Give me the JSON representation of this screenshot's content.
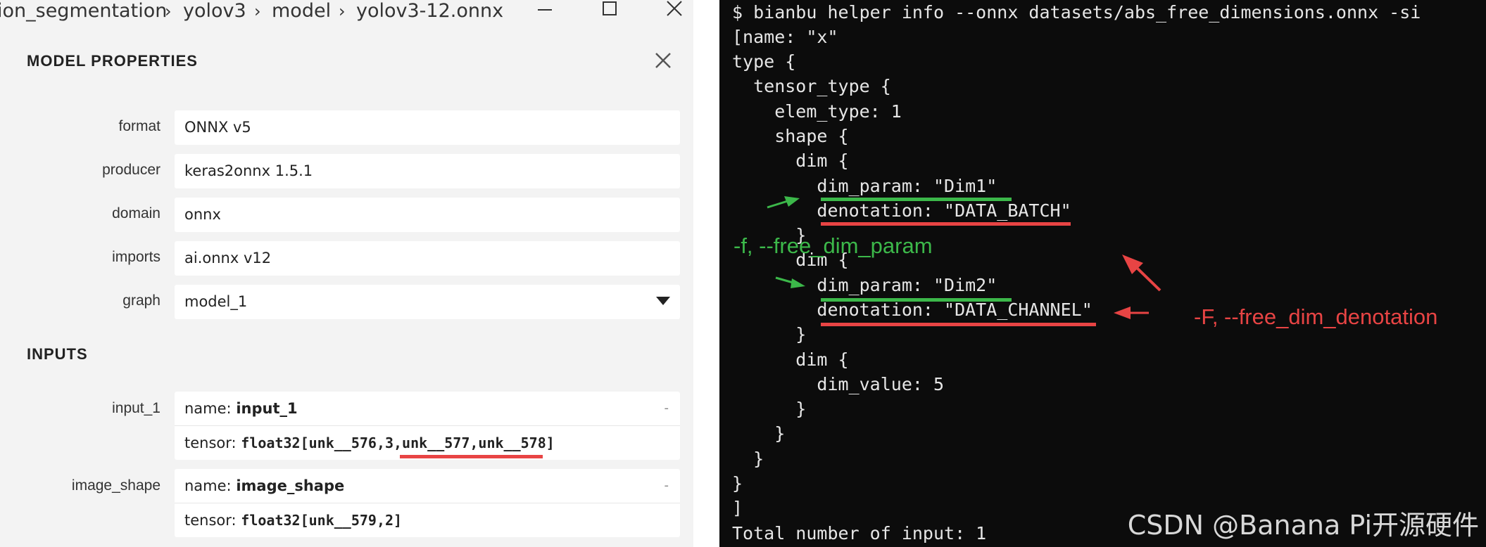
{
  "netron": {
    "breadcrumb": [
      "ion_segmentation",
      "yolov3",
      "model",
      "yolov3-12.onnx"
    ],
    "breadcrumb_sep": "›",
    "properties_title": "MODEL PROPERTIES",
    "properties": [
      {
        "label": "format",
        "value": "ONNX v5"
      },
      {
        "label": "producer",
        "value": "keras2onnx 1.5.1"
      },
      {
        "label": "domain",
        "value": "onnx"
      },
      {
        "label": "imports",
        "value": "ai.onnx v12"
      },
      {
        "label": "graph",
        "value": "model_1"
      }
    ],
    "inputs_title": "INPUTS",
    "inputs": [
      {
        "label": "input_1",
        "name_prefix": "name: ",
        "name": "input_1",
        "tensor_prefix": "tensor: ",
        "tensor": "float32[unk__576,3,unk__577,unk__578]",
        "collapse": "-"
      },
      {
        "label": "image_shape",
        "name_prefix": "name: ",
        "name": "image_shape",
        "tensor_prefix": "tensor: ",
        "tensor": "float32[unk__579,2]",
        "collapse": "-"
      }
    ]
  },
  "terminal": {
    "lines": [
      "$ bianbu helper info --onnx datasets/abs_free_dimensions.onnx -si",
      "[name: \"x\"",
      "type {",
      "  tensor_type {",
      "    elem_type: 1",
      "    shape {",
      "      dim {",
      "        dim_param: \"Dim1\"",
      "        denotation: \"DATA_BATCH\"",
      "      }",
      "      dim {",
      "        dim_param: \"Dim2\"",
      "        denotation: \"DATA_CHANNEL\"",
      "      }",
      "      dim {",
      "        dim_value: 5",
      "      }",
      "    }",
      "  }",
      "}",
      "]",
      "Total number of input: 1"
    ],
    "annotation_param": "-f, --free_dim_param",
    "annotation_denotation": "-F, --free_dim_denotation",
    "watermark": "CSDN @Banana Pi开源硬件"
  },
  "colors": {
    "green": "#3cb84a",
    "red": "#e84444",
    "terminal_bg": "#0c0c0c",
    "panel_bg": "#f3f3f3"
  }
}
